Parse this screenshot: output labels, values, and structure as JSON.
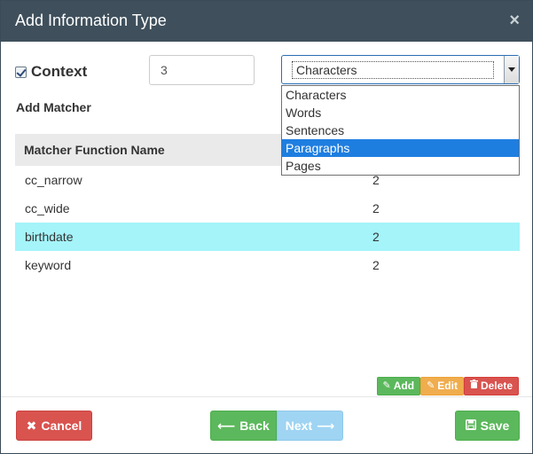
{
  "dialog": {
    "title": "Add Information Type",
    "close_icon": "×"
  },
  "context": {
    "label": "Context",
    "checked": true,
    "value": "3"
  },
  "unit_select": {
    "selected": "Characters",
    "options": [
      "Characters",
      "Words",
      "Sentences",
      "Paragraphs",
      "Pages"
    ],
    "highlighted": "Paragraphs"
  },
  "add_matcher": {
    "label": "Add Matcher"
  },
  "table": {
    "header": "Matcher Function Name",
    "rows": [
      {
        "name": "cc_narrow",
        "count": "2"
      },
      {
        "name": "cc_wide",
        "count": "2"
      },
      {
        "name": "birthdate",
        "count": "2"
      },
      {
        "name": "keyword",
        "count": "2"
      }
    ],
    "highlighted_row": "birthdate"
  },
  "row_actions": {
    "add": "Add",
    "edit": "Edit",
    "delete": "Delete"
  },
  "footer": {
    "cancel": "Cancel",
    "back": "Back",
    "next": "Next",
    "save": "Save"
  },
  "colors": {
    "header_bg": "#3f505c",
    "success": "#5cb85c",
    "danger": "#d9534f",
    "warning": "#f0ad4e",
    "info_light": "#9fd4f3",
    "row_highlight": "#a4f4fa",
    "dropdown_selected": "#1e7ee0"
  }
}
